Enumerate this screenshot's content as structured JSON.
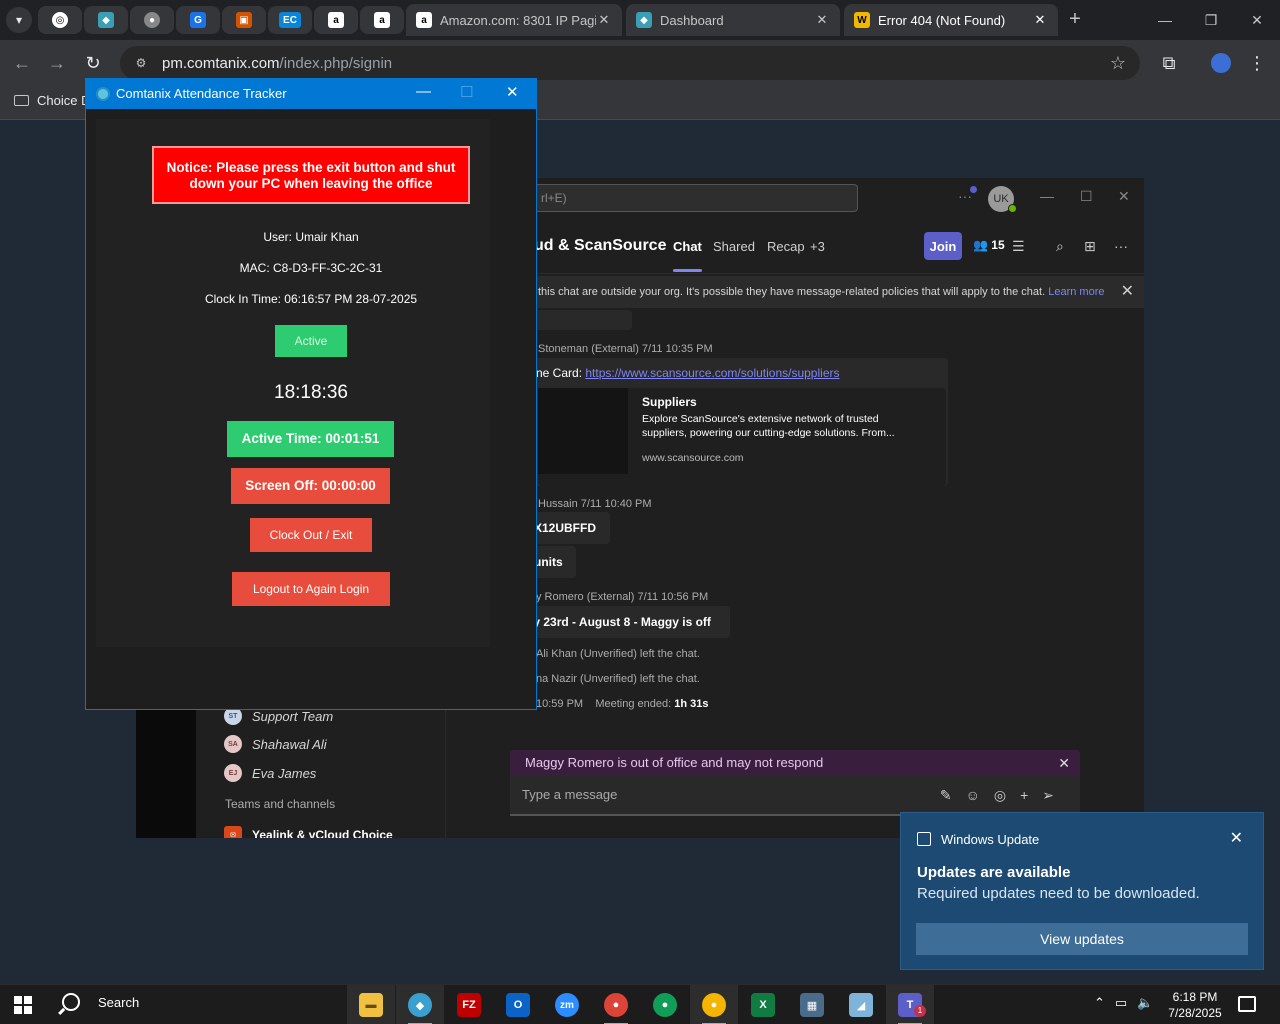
{
  "browser": {
    "tabs": [
      {
        "title": "Amazon.com: 8301 IP Pagin",
        "icon": "amazon-icon"
      },
      {
        "title": "Dashboard",
        "icon": "dashboard-icon"
      },
      {
        "title": "Error 404 (Not Found)",
        "icon": "w-icon"
      }
    ],
    "url_host": "pm.comtanix.com",
    "url_path": "/index.php/signin",
    "bookmark": "Choice D"
  },
  "teams": {
    "search_placeholder": "rl+E)",
    "me_initials": "UK",
    "chat_title": "ud & ScanSource",
    "tabs": [
      "Chat",
      "Shared",
      "Recap",
      "+3"
    ],
    "join_label": "Join",
    "participants": "15",
    "banner_text": "this chat are outside your org. It's possible they have message-related policies that will apply to the chat.",
    "banner_link": "Learn more",
    "messages": {
      "m1_meta": "Stoneman (External)  7/11 10:35 PM",
      "m1_prefix": "ne Card:",
      "m1_link": "https://www.scansource.com/solutions/suppliers",
      "card_title": "Suppliers",
      "card_desc1": "Explore ScanSource's extensive network of trusted",
      "card_desc2": "suppliers, powering our cutting-edge solutions. From...",
      "card_domain": "www.scansource.com",
      "m2_meta": "Hussain  7/11 10:40 PM",
      "m2_text1": "X12UBFFD",
      "m2_text2": "units",
      "m3_meta": "y Romero (External)  7/11 10:56 PM",
      "m3_text": "ly 23rd - August 8 - Maggy is off",
      "sys1": "Ali Khan (Unverified) left the chat.",
      "sys2": "na Nazir (Unverified) left the chat.",
      "sys3_time": "10:59 PM",
      "sys3_label": "Meeting ended:",
      "sys3_value": "1h 31s"
    },
    "contacts": [
      {
        "initials": "ST",
        "name": "Support Team"
      },
      {
        "initials": "SA",
        "name": "Shahawal Ali"
      },
      {
        "initials": "EJ",
        "name": "Eva James"
      }
    ],
    "teams_section": "Teams and channels",
    "team_item": "Yealink & vCloud Choice",
    "ooo_text": "Maggy Romero is out of office and may not respond",
    "compose_placeholder": "Type a message"
  },
  "tracker": {
    "title": "Comtanix Attendance Tracker",
    "notice": "Notice: Please press the exit button and shut down your PC when leaving the office",
    "user": "User: Umair Khan",
    "mac": "MAC: C8-D3-FF-3C-2C-31",
    "clock_in": "Clock In Time: 06:16:57 PM 28-07-2025",
    "status": "Active",
    "time": "18:18:36",
    "active_time": "Active Time: 00:01:51",
    "screen_off": "Screen Off: 00:00:00",
    "clock_out": "Clock Out / Exit",
    "logout": "Logout to Again Login"
  },
  "toast": {
    "source": "Windows Update",
    "heading": "Updates are available",
    "body": "Required updates need to be downloaded.",
    "action": "View updates"
  },
  "taskbar": {
    "search_label": "Search",
    "time": "6:18 PM",
    "date": "7/28/2025",
    "teams_badge": "1"
  },
  "colors": {
    "tracker_title": "#0078d4",
    "notice_bg": "#ff0000",
    "active_green": "#2ecc71",
    "danger_red": "#e74c3c",
    "teams_accent": "#5b5fc7",
    "toast_bg": "#1c4a73"
  }
}
